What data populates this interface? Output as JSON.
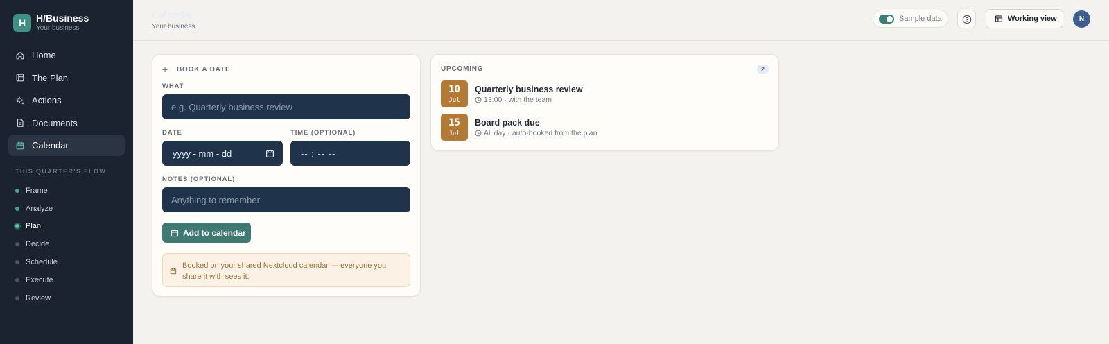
{
  "brand": {
    "logo_letter": "H",
    "name": "H/Business",
    "subtitle": "Your business"
  },
  "nav": [
    {
      "label": "Home",
      "icon": "home-icon",
      "active": false
    },
    {
      "label": "The Plan",
      "icon": "plan-icon",
      "active": false
    },
    {
      "label": "Actions",
      "icon": "sparkle-icon",
      "active": false
    },
    {
      "label": "Documents",
      "icon": "document-icon",
      "active": false
    },
    {
      "label": "Calendar",
      "icon": "calendar-icon",
      "active": true
    }
  ],
  "flow": {
    "title": "THIS QUARTER'S FLOW",
    "steps": [
      {
        "label": "Frame",
        "state": "done"
      },
      {
        "label": "Analyze",
        "state": "done"
      },
      {
        "label": "Plan",
        "state": "current"
      },
      {
        "label": "Decide",
        "state": "pending"
      },
      {
        "label": "Schedule",
        "state": "pending"
      },
      {
        "label": "Execute",
        "state": "pending"
      },
      {
        "label": "Review",
        "state": "pending"
      }
    ]
  },
  "header": {
    "title": "Calendar",
    "subtitle": "Your business",
    "sample_data_label": "Sample data",
    "sample_data_on": true,
    "view_label": "Working view",
    "avatar_initial": "N"
  },
  "book": {
    "heading": "BOOK A DATE",
    "what_label": "WHAT",
    "what_placeholder": "e.g. Quarterly business review",
    "date_label": "DATE",
    "date_placeholder": "yyyy - mm - dd",
    "time_label": "TIME (OPTIONAL)",
    "time_placeholder": "-- : --  --",
    "notes_label": "NOTES (OPTIONAL)",
    "notes_placeholder": "Anything to remember",
    "add_label": "Add to calendar",
    "info_text": "Booked on your shared Nextcloud calendar — everyone you share it with sees it."
  },
  "upcoming": {
    "title": "UPCOMING",
    "count": "2",
    "events": [
      {
        "day": "10",
        "month": "Jul",
        "title": "Quarterly business review",
        "meta": "13:00 · with the team"
      },
      {
        "day": "15",
        "month": "Jul",
        "title": "Board pack due",
        "meta": "All day · auto-booked from the plan"
      }
    ]
  },
  "colors": {
    "sidebar": "#1b2331",
    "accent": "#3e7a72",
    "input_bg": "#1f344a",
    "date_chip": "#b37a36"
  }
}
